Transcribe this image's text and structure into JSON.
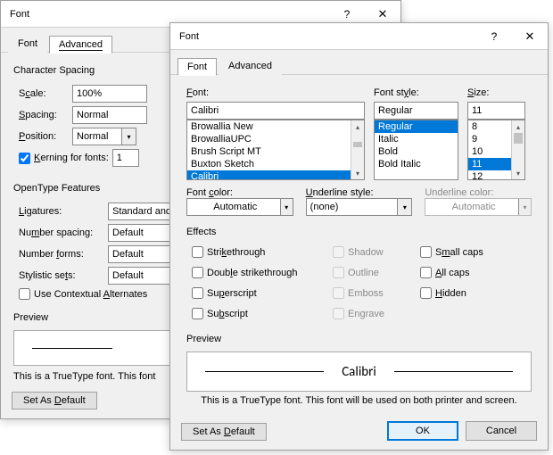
{
  "dialog1": {
    "title": "Font",
    "tabs": {
      "font": "Font",
      "advanced": "Advanced"
    },
    "charSpacing": {
      "legend": "Character Spacing",
      "scaleLabel": "Scale:",
      "scaleVal": "100%",
      "spacingLabel": "Spacing:",
      "spacingVal": "Normal",
      "positionLabel": "Position:",
      "positionVal": "Normal",
      "kerningLabel": "Kerning for fonts:",
      "kerningVal": "1"
    },
    "openType": {
      "legend": "OpenType Features",
      "ligaturesLabel": "Ligatures:",
      "ligaturesVal": "Standard and",
      "numSpacingLabel": "Number spacing:",
      "numSpacingVal": "Default",
      "numFormsLabel": "Number forms:",
      "numFormsVal": "Default",
      "styleSetsLabel": "Stylistic sets:",
      "styleSetsVal": "Default",
      "contextualLabel": "Use Contextual Alternates"
    },
    "preview": {
      "legend": "Preview",
      "info": "This is a TrueType font. This font"
    },
    "setDefault": "Set As Default"
  },
  "dialog2": {
    "title": "Font",
    "tabs": {
      "font": "Font",
      "advanced": "Advanced"
    },
    "font": {
      "label": "Font:",
      "value": "Calibri",
      "list": [
        "Browallia New",
        "BrowalliaUPC",
        "Brush Script MT",
        "Buxton Sketch",
        "Calibri"
      ]
    },
    "style": {
      "label": "Font style:",
      "value": "Regular",
      "list": [
        "Regular",
        "Italic",
        "Bold",
        "Bold Italic"
      ]
    },
    "size": {
      "label": "Size:",
      "value": "11",
      "list": [
        "8",
        "9",
        "10",
        "11",
        "12"
      ]
    },
    "fontColor": {
      "label": "Font color:",
      "value": "Automatic"
    },
    "underlineStyle": {
      "label": "Underline style:",
      "value": "(none)"
    },
    "underlineColor": {
      "label": "Underline color:",
      "value": "Automatic"
    },
    "effects": {
      "legend": "Effects",
      "strikethrough": "Strikethrough",
      "doubleStrike": "Double strikethrough",
      "superscript": "Superscript",
      "subscript": "Subscript",
      "shadow": "Shadow",
      "outline": "Outline",
      "emboss": "Emboss",
      "engrave": "Engrave",
      "smallcaps": "Small caps",
      "allcaps": "All caps",
      "hidden": "Hidden"
    },
    "preview": {
      "legend": "Preview",
      "sample": "Calibri",
      "info": "This is a TrueType font. This font will be used on both printer and screen."
    },
    "setDefault": "Set As Default",
    "ok": "OK",
    "cancel": "Cancel"
  }
}
